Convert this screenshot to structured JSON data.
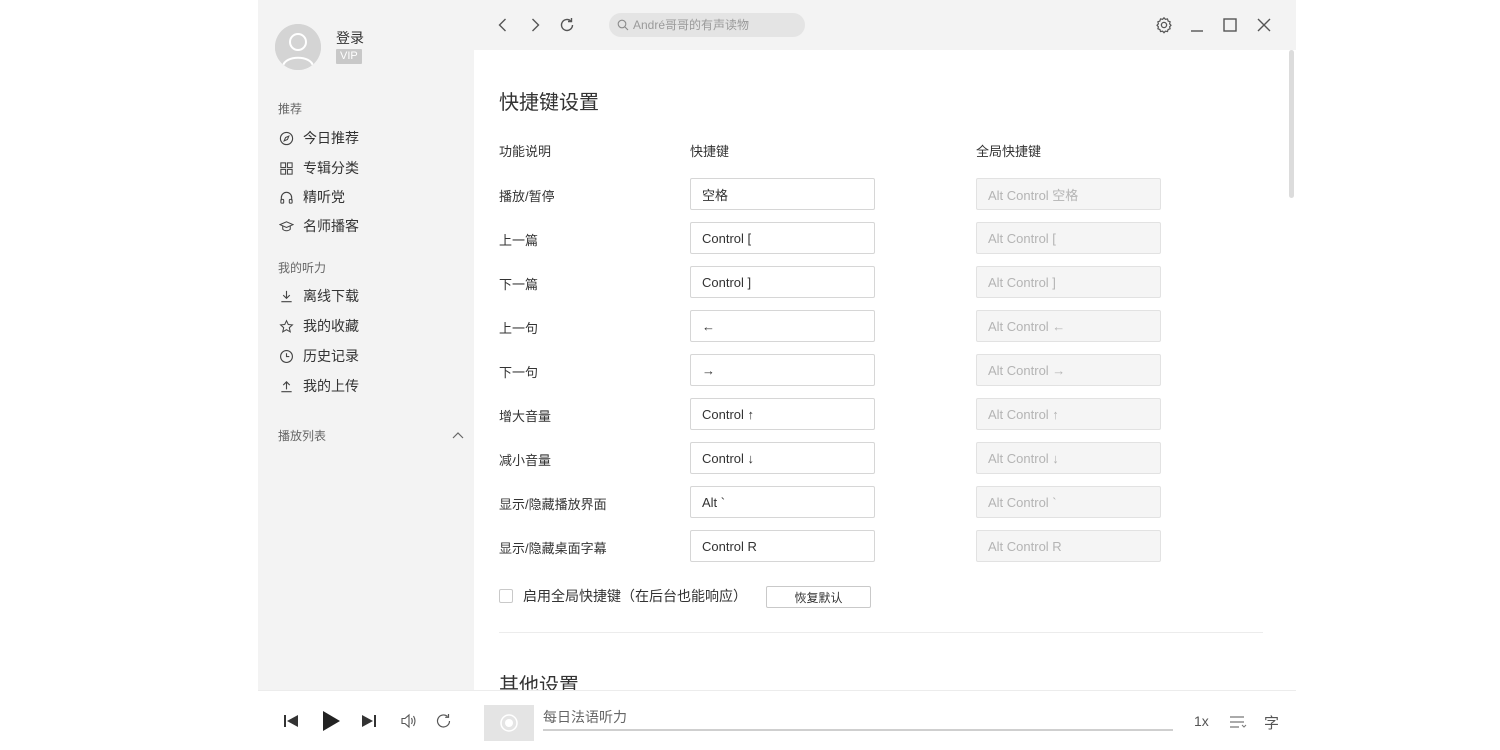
{
  "user": {
    "login_label": "登录",
    "vip_badge": "VIP"
  },
  "sidebar": {
    "section_recommend": "推荐",
    "recommend_items": [
      {
        "label": "今日推荐",
        "icon": "compass-icon"
      },
      {
        "label": "专辑分类",
        "icon": "grid-icon"
      },
      {
        "label": "精听党",
        "icon": "headphones-icon"
      },
      {
        "label": "名师播客",
        "icon": "graduation-cap-icon"
      }
    ],
    "section_mine": "我的听力",
    "mine_items": [
      {
        "label": "离线下载",
        "icon": "download-icon"
      },
      {
        "label": "我的收藏",
        "icon": "star-icon"
      },
      {
        "label": "历史记录",
        "icon": "clock-icon"
      },
      {
        "label": "我的上传",
        "icon": "upload-icon"
      }
    ],
    "playlist_label": "播放列表"
  },
  "topbar": {
    "search_placeholder": "André哥哥的有声读物"
  },
  "settings": {
    "title": "快捷键设置",
    "col_function": "功能说明",
    "col_shortcut": "快捷键",
    "col_global": "全局快捷键",
    "rows": [
      {
        "label": "播放/暂停",
        "shortcut": "空格",
        "global": "Alt Control 空格"
      },
      {
        "label": "上一篇",
        "shortcut": "Control [",
        "global": "Alt Control ["
      },
      {
        "label": "下一篇",
        "shortcut": "Control ]",
        "global": "Alt Control ]"
      },
      {
        "label": "上一句",
        "shortcut": "←",
        "global": "Alt Control ←"
      },
      {
        "label": "下一句",
        "shortcut": "→",
        "global": "Alt Control →"
      },
      {
        "label": "增大音量",
        "shortcut": "Control ↑",
        "global": "Alt Control ↑"
      },
      {
        "label": "减小音量",
        "shortcut": "Control ↓",
        "global": "Alt Control ↓"
      },
      {
        "label": "显示/隐藏播放界面",
        "shortcut": "Alt `",
        "global": "Alt Control `"
      },
      {
        "label": "显示/隐藏桌面字幕",
        "shortcut": "Control R",
        "global": "Alt Control R"
      }
    ],
    "enable_global_label": "启用全局快捷键（在后台也能响应）",
    "enable_global_checked": false,
    "reset_label": "恢复默认",
    "other_title": "其他设置"
  },
  "player": {
    "track_title": "每日法语听力",
    "speed": "1x",
    "subtitle_label": "字",
    "progress": 0
  },
  "colors": {
    "sidebar_bg": "#f3f3f3",
    "text": "#333333",
    "muted": "#999999"
  }
}
